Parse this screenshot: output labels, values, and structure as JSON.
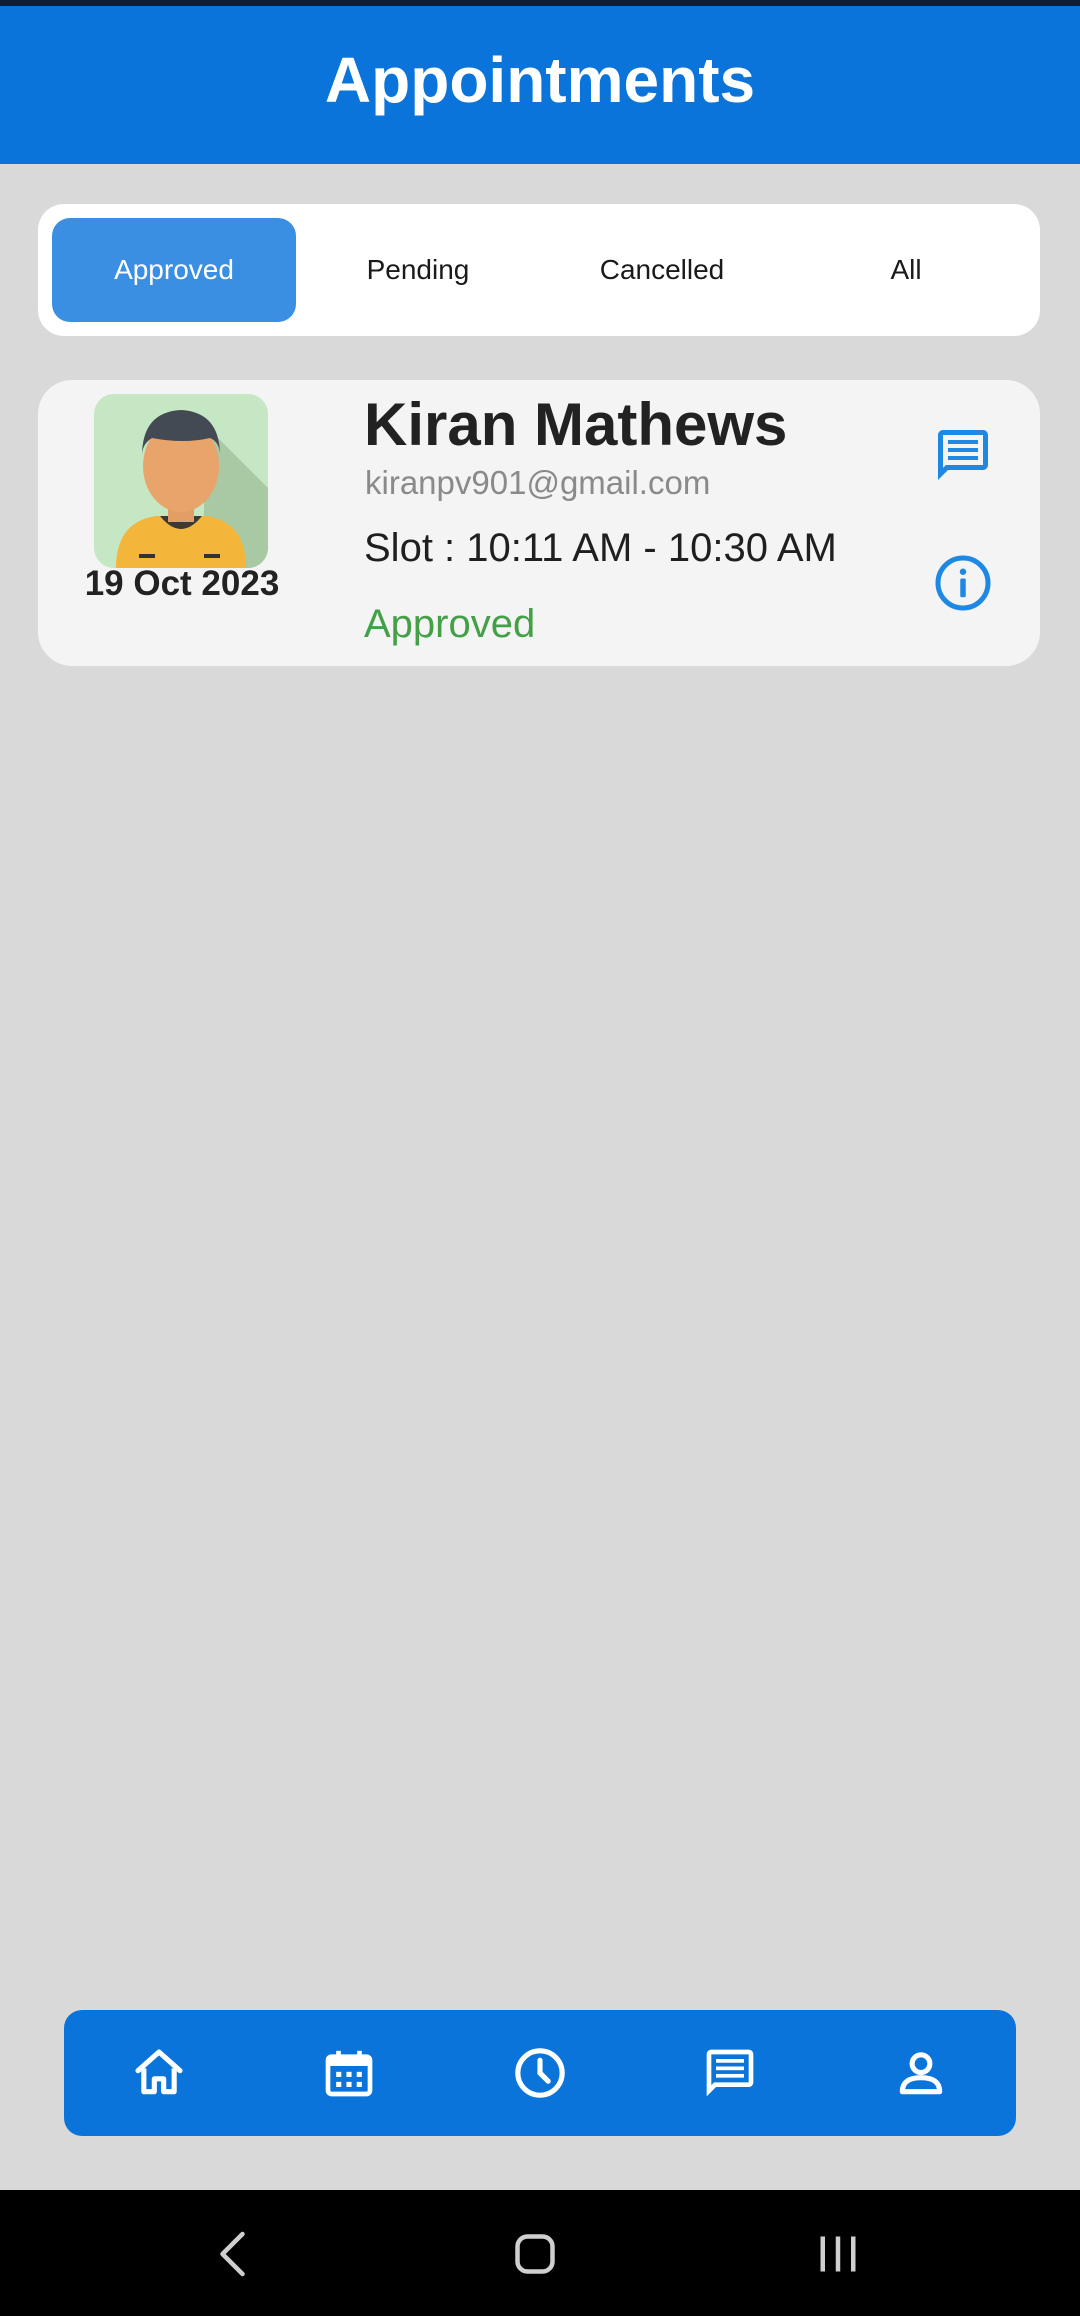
{
  "app_bar": {
    "title": "Appointments"
  },
  "tabs": [
    {
      "label": "Approved",
      "active": true
    },
    {
      "label": "Pending",
      "active": false
    },
    {
      "label": "Cancelled",
      "active": false
    },
    {
      "label": "All",
      "active": false
    }
  ],
  "appointments": [
    {
      "date": "19 Oct 2023",
      "name": "Kiran Mathews",
      "email": "kiranpv901@gmail.com",
      "slot": "Slot : 10:11 AM - 10:30 AM",
      "status": "Approved",
      "actions": [
        "chat-icon",
        "info-icon"
      ]
    }
  ],
  "bottom_nav": [
    "home-icon",
    "calendar-icon",
    "clock-icon",
    "chat-icon",
    "person-icon"
  ],
  "system_nav": [
    "back-icon",
    "home-button-icon",
    "recents-icon"
  ],
  "colors": {
    "primary": "#0a74da",
    "active_tab": "#3a8fe3",
    "approved": "#43a047",
    "background": "#d9d9d9",
    "icon_blue": "#1e88e5"
  }
}
